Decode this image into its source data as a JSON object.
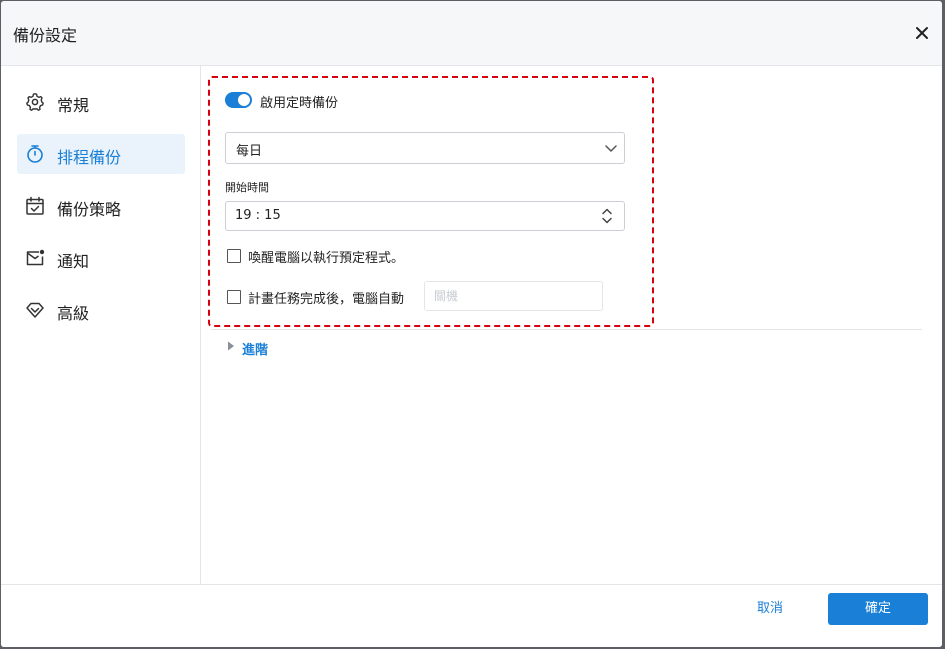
{
  "dialog": {
    "title": "備份設定",
    "close_icon": "close-icon"
  },
  "sidebar": {
    "items": [
      {
        "label": "常規",
        "icon": "gear-icon",
        "active": false
      },
      {
        "label": "排程備份",
        "icon": "stopwatch-icon",
        "active": true
      },
      {
        "label": "備份策略",
        "icon": "calendar-check-icon",
        "active": false
      },
      {
        "label": "通知",
        "icon": "mail-notification-icon",
        "active": false
      },
      {
        "label": "高級",
        "icon": "diamond-icon",
        "active": false
      }
    ]
  },
  "schedule": {
    "enable_label": "啟用定時備份",
    "enabled": true,
    "frequency_value": "每日",
    "start_time_label": "開始時間",
    "start_time_value": "19 : 15",
    "wake_label": "喚醒電腦以執行預定程式。",
    "wake_checked": false,
    "after_label": "計畫任務完成後，電腦自動",
    "after_checked": false,
    "after_action_placeholder": "關機"
  },
  "advanced": {
    "label": "進階"
  },
  "footer": {
    "cancel_label": "取消",
    "ok_label": "確定"
  },
  "colors": {
    "accent": "#1a7fd6",
    "highlight_border": "#d9000d",
    "active_bg": "#eaf3fc"
  }
}
